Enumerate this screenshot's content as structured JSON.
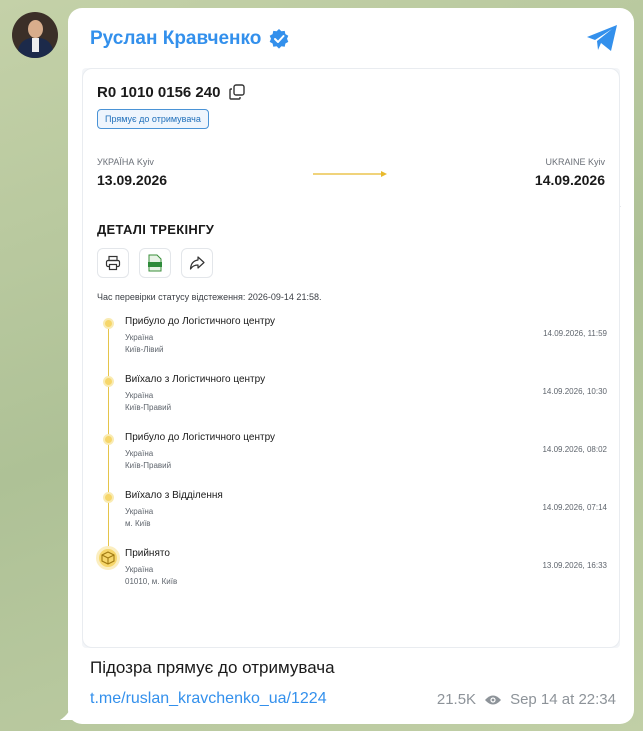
{
  "author": {
    "name": "Руслан Кравченко"
  },
  "tracking": {
    "number": "R0 1010 0156 240",
    "direction_tag": "Прямує до отримувача",
    "from": {
      "country": "УКРАЇНА Kyiv",
      "date": "13.09.2026"
    },
    "to": {
      "country": "UKRAINE Kyiv",
      "date": "14.09.2026"
    },
    "details_title": "ДЕТАЛІ ТРЕКІНГУ",
    "check_time": "Час перевірки статусу відстеження: 2026-09-14 21:58.",
    "events": [
      {
        "status": "Прибуло до Логістичного центру",
        "country": "Україна",
        "city": "Київ-Лівий",
        "time": "14.09.2026, 11:59"
      },
      {
        "status": "Виїхало з Логістичного центру",
        "country": "Україна",
        "city": "Київ-Правий",
        "time": "14.09.2026, 10:30"
      },
      {
        "status": "Прибуло до Логістичного центру",
        "country": "Україна",
        "city": "Київ-Правий",
        "time": "14.09.2026, 08:02"
      },
      {
        "status": "Виїхало з Відділення",
        "country": "Україна",
        "city": "м. Київ",
        "time": "14.09.2026, 07:14"
      },
      {
        "status": "Прийнято",
        "country": "Україна",
        "city": "01010, м. Київ",
        "time": "13.09.2026, 16:33"
      }
    ]
  },
  "post": {
    "caption": "Підозра прямує до отримувача",
    "link": "t.me/ruslan_kravchenko_ua/1224",
    "views": "21.5K",
    "date": "Sep 14 at 22:34"
  },
  "icons": {
    "verified": "verified-badge-icon",
    "share": "telegram-share-icon",
    "copy": "copy-icon",
    "print": "printer-icon",
    "csv": "csv-file-icon",
    "forward": "share-arrow-icon",
    "views": "eye-icon"
  },
  "colors": {
    "accent": "#3390ec",
    "timeline": "#f6d66a",
    "tag": "#4a93d6"
  }
}
